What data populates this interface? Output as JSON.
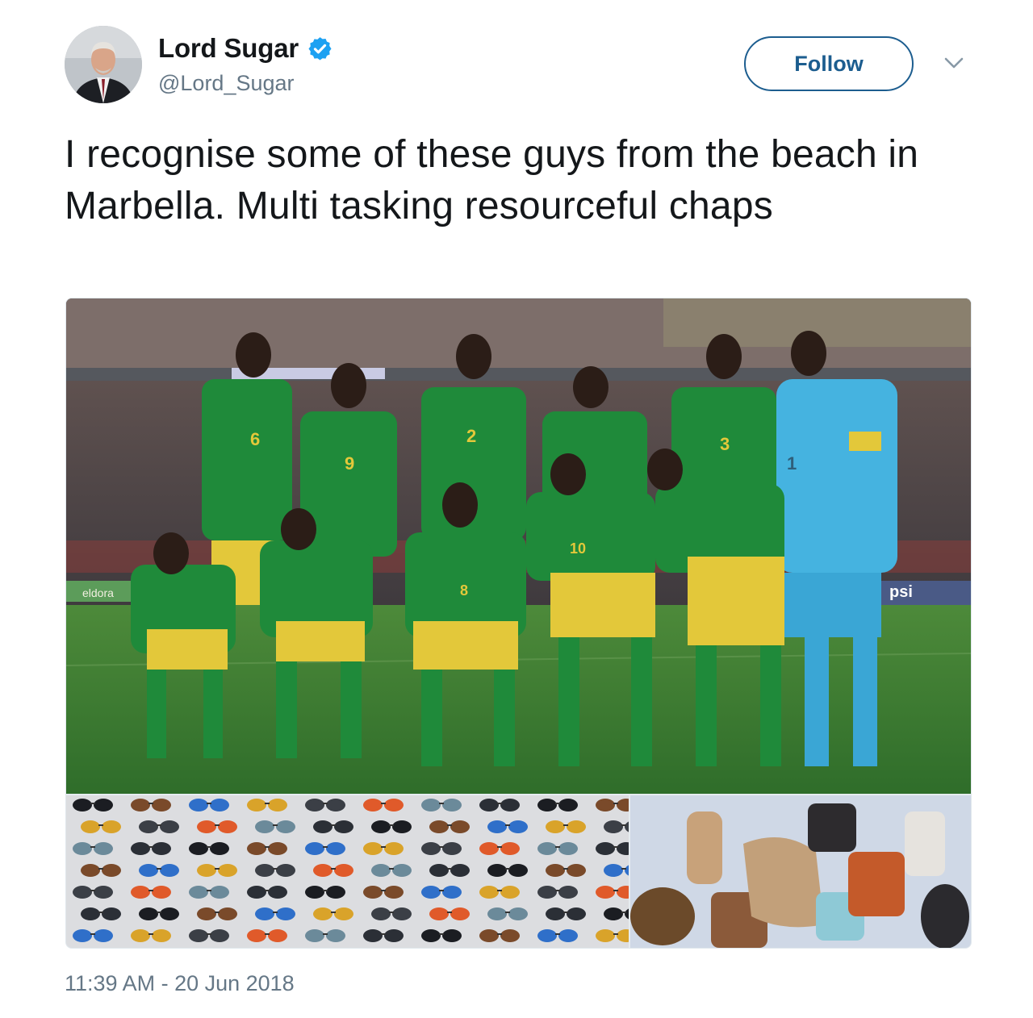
{
  "user": {
    "display_name": "Lord Sugar",
    "handle": "@Lord_Sugar",
    "verified": true
  },
  "follow_button": {
    "label": "Follow"
  },
  "tweet": {
    "text": "I recognise some of these guys from the beach in Marbella. Multi tasking resourceful chaps",
    "timestamp": "11:39 AM - 20 Jun 2018"
  },
  "media": {
    "photo_main": {
      "jersey_numbers": [
        "6",
        "9",
        "2",
        "3",
        "1",
        "10",
        "8"
      ],
      "board_text_left": "eldora",
      "board_text_right": "psi"
    }
  },
  "icons": {
    "verified": "verified-badge-icon",
    "caret": "chevron-down-icon"
  },
  "colors": {
    "accent": "#1c5d8f",
    "verified": "#1da1f2",
    "text_primary": "#14171a",
    "text_secondary": "#657786",
    "jersey_green": "#1f8a3a",
    "shorts_yellow": "#e3c83a",
    "keeper_blue": "#45b3e0"
  }
}
